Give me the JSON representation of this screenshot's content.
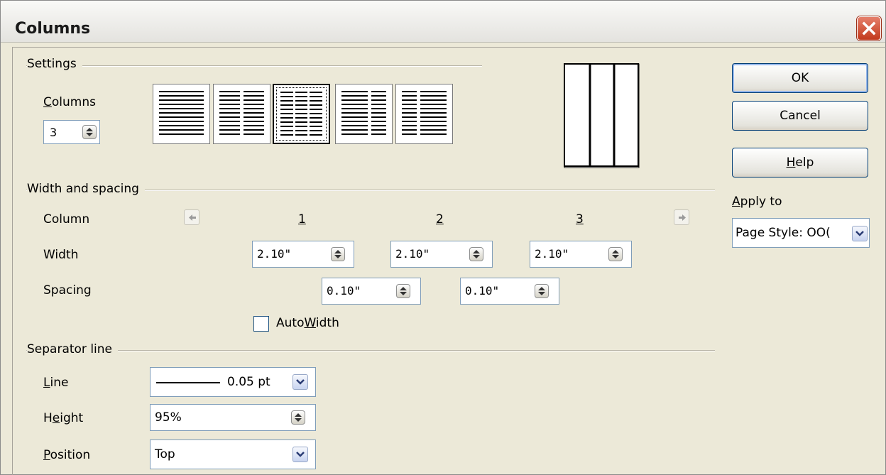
{
  "window": {
    "title": "Columns"
  },
  "settings": {
    "section_label": "Settings",
    "columns_label_prefix": "",
    "columns_label_mnemonic": "C",
    "columns_label_rest": "olumns",
    "columns_value": "3",
    "layout_presets": [
      {
        "name": "1 column",
        "columns": 1,
        "selected": false
      },
      {
        "name": "2 columns",
        "columns": 2,
        "selected": false
      },
      {
        "name": "3 columns",
        "columns": 3,
        "selected": true
      },
      {
        "name": "2 columns left large",
        "columns": 2,
        "selected": false
      },
      {
        "name": "2 columns right large",
        "columns": 2,
        "selected": false
      }
    ]
  },
  "width_spacing": {
    "section_label": "Width and spacing",
    "column_label": "Column",
    "width_label": "Width",
    "spacing_label": "Spacing",
    "column_numbers": [
      "1",
      "2",
      "3"
    ],
    "widths": [
      "2.10\"",
      "2.10\"",
      "2.10\""
    ],
    "spacings": [
      "0.10\"",
      "0.10\""
    ],
    "autowidth_prefix": "Auto",
    "autowidth_mnemonic": "W",
    "autowidth_rest": "idth",
    "autowidth_checked": false
  },
  "separator": {
    "section_label": "Separator line",
    "line_mnemonic": "L",
    "line_rest": "ine",
    "line_value": "0.05 pt",
    "height_prefix": "H",
    "height_mnemonic": "e",
    "height_rest": "ight",
    "height_value": "95%",
    "position_mnemonic": "P",
    "position_rest": "osition",
    "position_value": "Top"
  },
  "buttons": {
    "ok": "OK",
    "cancel": "Cancel",
    "help_mnemonic": "H",
    "help_rest": "elp"
  },
  "apply_to": {
    "mnemonic": "A",
    "rest": "pply to",
    "value": "Page Style: OO("
  },
  "colors": {
    "close_button": "#c2391c",
    "field_border": "#7f9db9",
    "dialog_bg": "#ece9d8"
  },
  "icons": [
    "close-icon",
    "spin-icon",
    "dropdown-arrow-icon",
    "left-arrow-icon",
    "right-arrow-icon"
  ]
}
